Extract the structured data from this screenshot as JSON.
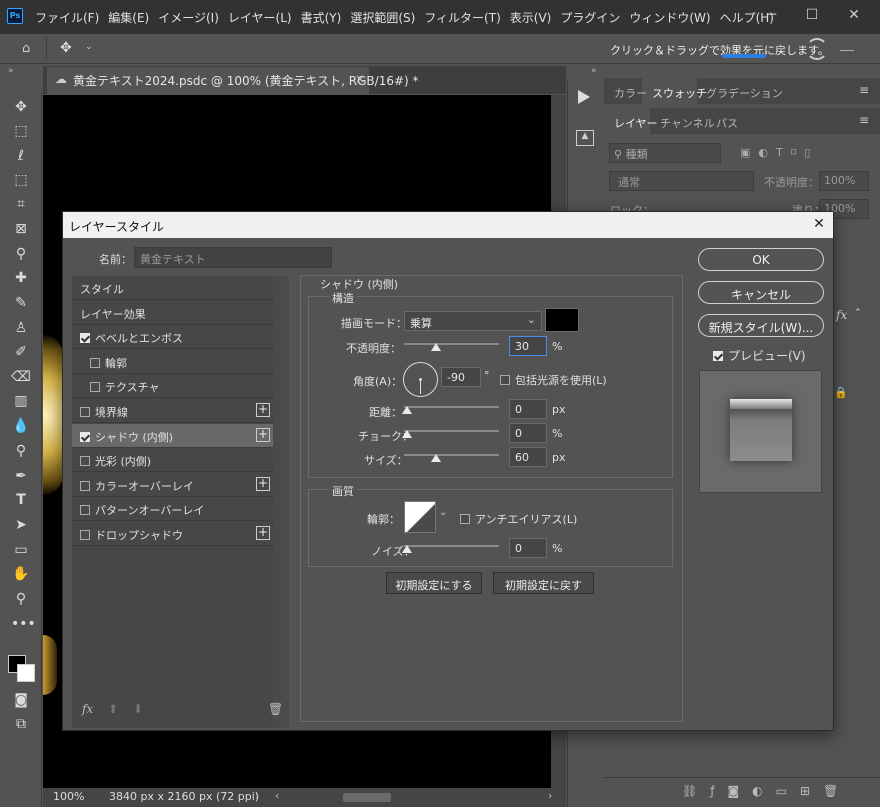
{
  "app": {
    "logo": "Ps",
    "menu": [
      "ファイル(F)",
      "編集(E)",
      "イメージ(I)",
      "レイヤー(L)",
      "書式(Y)",
      "選択範囲(S)",
      "フィルター(T)",
      "表示(V)",
      "プラグイン",
      "ウィンドウ(W)",
      "ヘルプ(H)"
    ],
    "hint": "クリック＆ドラッグで効果を元に戻します。"
  },
  "document": {
    "tab_title": "黄金テキスト2024.psdc @ 100% (黄金テキスト, RGB/16#) *",
    "zoom": "100%",
    "size": "3840 px x 2160 px (72 ppi)"
  },
  "panels": {
    "top_tabs": [
      "カラー",
      "スウォッチ",
      "グラデーション"
    ],
    "layer_tabs": [
      "レイヤー",
      "チャンネル",
      "パス"
    ],
    "kind_filter": "種類",
    "blend": "通常",
    "opacity_label": "不透明度：",
    "opacity_value": "100%",
    "lock_label": "ロック：",
    "fill_label": "塗り：",
    "fill_value": "100%"
  },
  "dialog": {
    "title": "レイヤースタイル",
    "name_label": "名前：",
    "name_value": "黄金テキスト",
    "styles": [
      {
        "label": "スタイル",
        "checkbox": false,
        "checked": false,
        "plus": false,
        "indent": false,
        "selected": false
      },
      {
        "label": "レイヤー効果",
        "checkbox": false,
        "checked": false,
        "plus": false,
        "indent": false,
        "selected": false
      },
      {
        "label": "ベベルとエンボス",
        "checkbox": true,
        "checked": true,
        "plus": false,
        "indent": false,
        "selected": false
      },
      {
        "label": "輪郭",
        "checkbox": true,
        "checked": false,
        "plus": false,
        "indent": true,
        "selected": false
      },
      {
        "label": "テクスチャ",
        "checkbox": true,
        "checked": false,
        "plus": false,
        "indent": true,
        "selected": false
      },
      {
        "label": "境界線",
        "checkbox": true,
        "checked": false,
        "plus": true,
        "indent": false,
        "selected": false
      },
      {
        "label": "シャドウ (内側)",
        "checkbox": true,
        "checked": true,
        "plus": true,
        "indent": false,
        "selected": true
      },
      {
        "label": "光彩 (内側)",
        "checkbox": true,
        "checked": false,
        "plus": false,
        "indent": false,
        "selected": false
      },
      {
        "label": "カラーオーバーレイ",
        "checkbox": true,
        "checked": false,
        "plus": true,
        "indent": false,
        "selected": false
      },
      {
        "label": "パターンオーバーレイ",
        "checkbox": true,
        "checked": false,
        "plus": false,
        "indent": false,
        "selected": false
      },
      {
        "label": "ドロップシャドウ",
        "checkbox": true,
        "checked": false,
        "plus": true,
        "indent": false,
        "selected": false
      }
    ],
    "section_title": "シャドウ (内側)",
    "structure": {
      "title": "構造",
      "blend_label": "描画モード：",
      "blend_value": "乗算",
      "shadow_color": "#000000",
      "opacity_label": "不透明度：",
      "opacity_value": "30",
      "opacity_unit": "%",
      "angle_label": "角度(A)：",
      "angle_value": "-90",
      "angle_unit": "°",
      "global_light_label": "包括光源を使用(L)",
      "global_light_checked": false,
      "distance_label": "距離：",
      "distance_value": "0",
      "distance_unit": "px",
      "choke_label": "チョーク：",
      "choke_value": "0",
      "choke_unit": "%",
      "size_label": "サイズ：",
      "size_value": "60",
      "size_unit": "px"
    },
    "quality": {
      "title": "画質",
      "contour_label": "輪郭：",
      "antialias_label": "アンチエイリアス(L)",
      "antialias_checked": false,
      "noise_label": "ノイズ：",
      "noise_value": "0",
      "noise_unit": "%"
    },
    "make_default": "初期設定にする",
    "reset_default": "初期設定に戻す",
    "ok": "OK",
    "cancel": "キャンセル",
    "new_style": "新規スタイル(W)...",
    "preview_label": "プレビュー(V)",
    "preview_checked": true,
    "fx_label": "fx"
  }
}
